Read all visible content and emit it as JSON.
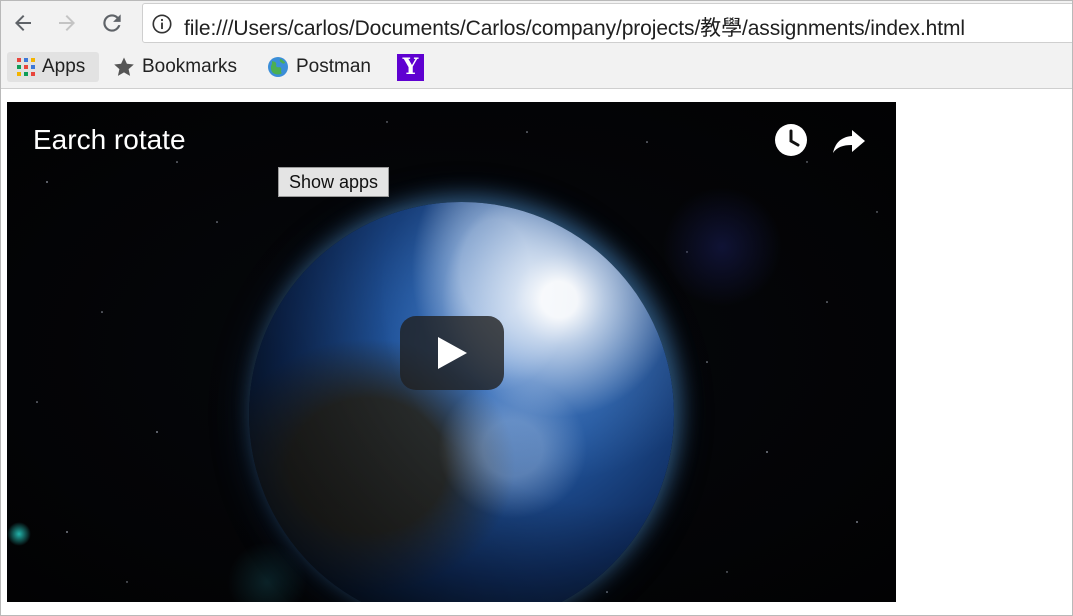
{
  "browser": {
    "url": "file:///Users/carlos/Documents/Carlos/company/projects/教學/assignments/index.html",
    "back_icon": "back-arrow-icon",
    "forward_icon": "forward-arrow-icon",
    "reload_icon": "reload-icon",
    "info_icon": "info-icon"
  },
  "bookmarks": {
    "items": [
      {
        "label": "Apps",
        "icon": "apps-grid-icon"
      },
      {
        "label": "Bookmarks",
        "icon": "star-icon"
      },
      {
        "label": "Postman",
        "icon": "globe-icon"
      },
      {
        "label": "",
        "icon": "yahoo-icon"
      }
    ]
  },
  "video": {
    "title": "Earch rotate",
    "tooltip": "Show apps",
    "icons": [
      "watch-later-icon",
      "share-icon",
      "play-icon"
    ]
  },
  "colors": {
    "toolbar_bg": "#f2f2f2",
    "video_bg": "#040507",
    "play_button_bg": "#212121",
    "yahoo_purple": "#5f01d1"
  }
}
